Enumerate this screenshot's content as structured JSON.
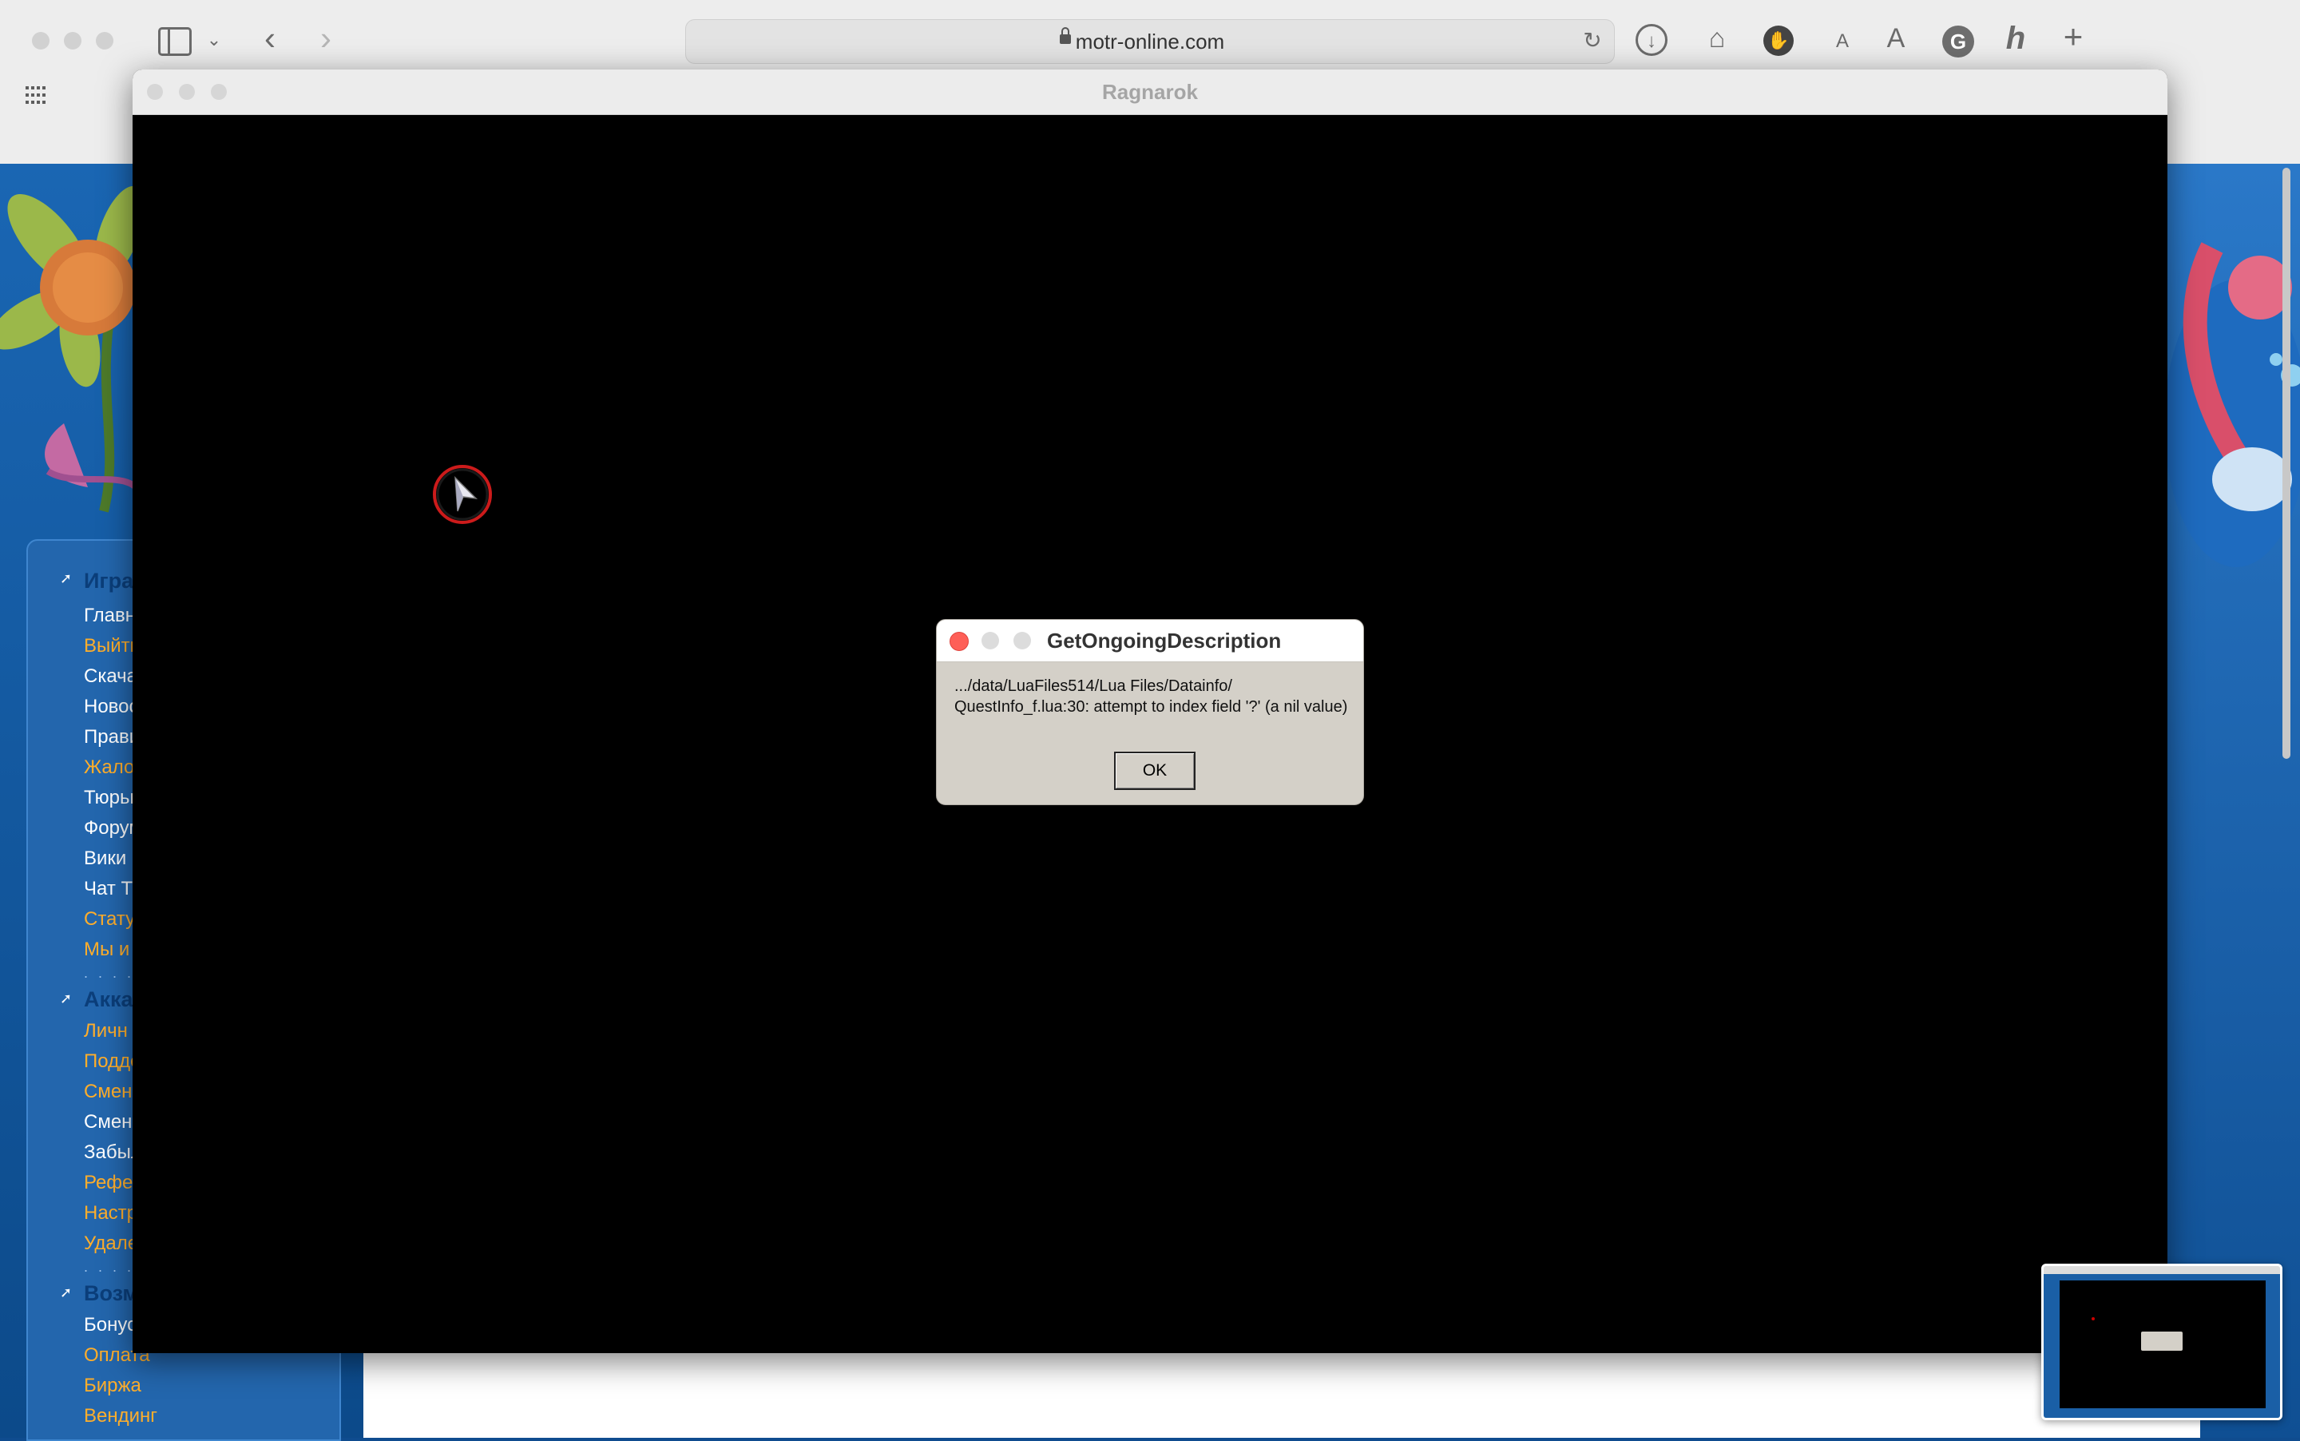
{
  "browser": {
    "url": "motr-online.com",
    "icons": [
      "sidebar-icon",
      "chevron-down-icon",
      "back-icon",
      "forward-icon",
      "lock-icon",
      "reload-icon",
      "download-icon",
      "home-icon",
      "hand-icon",
      "text-smaller-icon",
      "text-larger-icon",
      "grammarly-icon",
      "honey-icon",
      "new-tab-icon",
      "apps-grid-icon"
    ],
    "text_smaller_label": "A",
    "text_larger_label": "A"
  },
  "game_window": {
    "title": "Ragnarok"
  },
  "dialog": {
    "title": "GetOngoingDescription",
    "message": ".../data/LuaFiles514/Lua Files/Datainfo/\nQuestInfo_f.lua:30: attempt to index field '?' (a nil value)",
    "ok_label": "OK"
  },
  "sidebar": {
    "sections": [
      {
        "heading": "Игра",
        "items": [
          {
            "label": "Главн",
            "color": "white"
          },
          {
            "label": "Выйти",
            "color": "orange"
          },
          {
            "label": "Скача",
            "color": "white"
          },
          {
            "label": "Новос",
            "color": "white"
          },
          {
            "label": "Прави",
            "color": "white"
          },
          {
            "label": "Жало",
            "color": "orange"
          },
          {
            "label": "Тюрьм",
            "color": "white"
          },
          {
            "label": "Форум",
            "color": "white"
          },
          {
            "label": "Вики",
            "color": "white"
          },
          {
            "label": "Чат Т",
            "color": "white"
          },
          {
            "label": "Стату",
            "color": "orange"
          },
          {
            "label": "Мы и",
            "color": "orange"
          }
        ]
      },
      {
        "heading": "Акка",
        "items": [
          {
            "label": "Личн",
            "color": "orange"
          },
          {
            "label": "Подде",
            "color": "orange"
          },
          {
            "label": "Смена",
            "color": "orange"
          },
          {
            "label": "Смена",
            "color": "white"
          },
          {
            "label": "Забыл",
            "color": "white"
          },
          {
            "label": "Рефер",
            "color": "orange"
          },
          {
            "label": "Настр",
            "color": "orange"
          },
          {
            "label": "Удале",
            "color": "orange"
          }
        ]
      },
      {
        "heading": "Возм",
        "items": [
          {
            "label": "Бонус",
            "color": "white"
          },
          {
            "label": "Оплата",
            "color": "orange"
          },
          {
            "label": "Биржа",
            "color": "orange"
          },
          {
            "label": "Вендинг",
            "color": "orange"
          }
        ]
      }
    ],
    "dots": ". . . . . . . ."
  },
  "colors": {
    "accent_orange": "#ffae2b",
    "close_red": "#fe5f57",
    "page_blue": "#0f4c8f"
  }
}
